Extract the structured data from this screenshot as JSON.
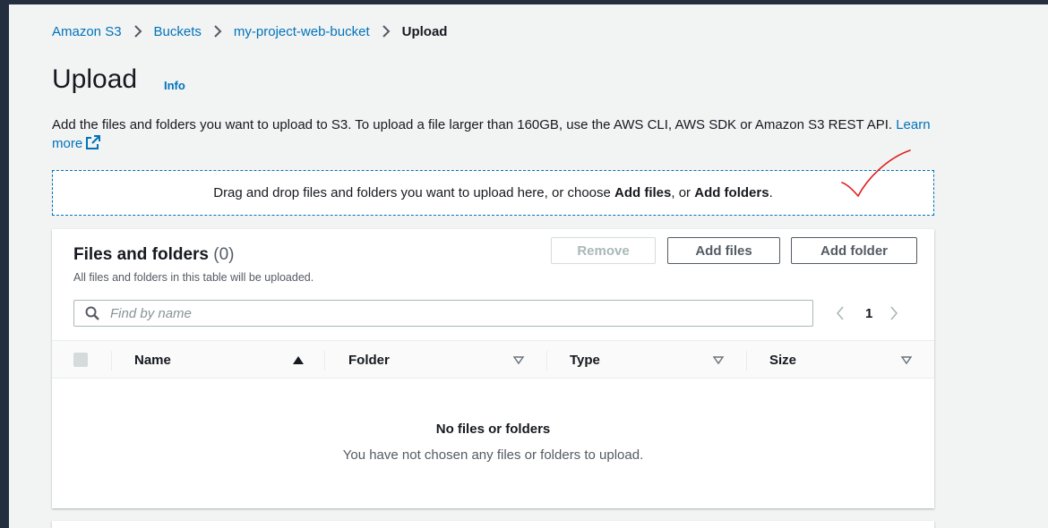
{
  "breadcrumb": {
    "items": [
      "Amazon S3",
      "Buckets",
      "my-project-web-bucket"
    ],
    "current": "Upload"
  },
  "page": {
    "title": "Upload",
    "info_label": "Info",
    "description": "Add the files and folders you want to upload to S3. To upload a file larger than 160GB, use the AWS CLI, AWS SDK or Amazon S3 REST API.",
    "learn_more": "Learn more"
  },
  "dropzone": {
    "prefix": "Drag and drop files and folders you want to upload here, or choose",
    "add_files": "Add files",
    "middle": ", or",
    "add_folders": "Add folders",
    "suffix": "."
  },
  "files_panel": {
    "title": "Files and folders",
    "count": "(0)",
    "subtitle": "All files and folders in this table will be uploaded.",
    "buttons": {
      "remove": "Remove",
      "add_files": "Add files",
      "add_folder": "Add folder"
    },
    "search_placeholder": "Find by name",
    "page_number": "1",
    "columns": [
      "Name",
      "Folder",
      "Type",
      "Size"
    ],
    "empty_title": "No files or folders",
    "empty_message": "You have not chosen any files or folders to upload."
  },
  "colors": {
    "link": "#0073bb",
    "text": "#16191f",
    "muted": "#545b64",
    "annotation": "#e02020"
  }
}
